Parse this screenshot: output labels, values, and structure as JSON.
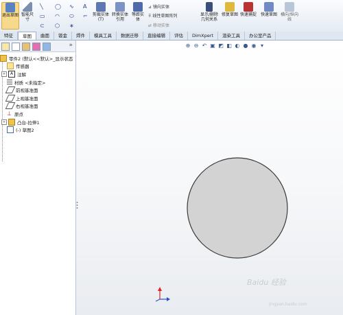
{
  "ribbon": {
    "exit_sketch": "退出草图",
    "smart_dimension": "智能尺寸",
    "trim_entities": "剪裁实体(T)",
    "convert_entities": "转换实体引用",
    "offset_entities": "等距实体",
    "mirror_entities": "镜向实体",
    "linear_pattern": "线性草图阵列",
    "move_entities": "移动实体",
    "display_delete": "显示/删除几何关系",
    "repair_sketch": "修复草图",
    "rapid_sketch": "快速捕捉",
    "quick_sketch": "快速草图",
    "instant2d": "横向/纵向线"
  },
  "tabs": [
    "特征",
    "草图",
    "曲面",
    "钣金",
    "焊件",
    "模具工具",
    "数据迁移",
    "直接编辑",
    "评估",
    "DimXpert",
    "渲染工具",
    "办公室产品"
  ],
  "active_tab": 1,
  "tree": {
    "root": "零件2 (默认<<默认>_显示状态",
    "items": [
      {
        "label": "传感器",
        "icon": "sensor-icon",
        "expander": ""
      },
      {
        "label": "注解",
        "icon": "annotation-icon",
        "expander": "+"
      },
      {
        "label": "材质 <未指定>",
        "icon": "material-icon",
        "expander": ""
      },
      {
        "label": "前视基准面",
        "icon": "plane-icon",
        "expander": ""
      },
      {
        "label": "上视基准面",
        "icon": "plane-icon",
        "expander": ""
      },
      {
        "label": "右视基准面",
        "icon": "plane-icon",
        "expander": ""
      },
      {
        "label": "原点",
        "icon": "origin-icon",
        "expander": ""
      },
      {
        "label": "凸台-拉伸1",
        "icon": "extrude-icon",
        "expander": "+"
      },
      {
        "label": "(-) 草图2",
        "icon": "sketch-icon",
        "expander": ""
      }
    ]
  },
  "panel": {
    "collapse_glyph": "»"
  },
  "colors": {
    "circle_fill": "#d3d3d3",
    "circle_stroke": "#3a3a3a",
    "active_button": "#f7d98b"
  },
  "watermark": {
    "text": "Baidu 经验",
    "sub": "jingyan.baidu.com"
  }
}
